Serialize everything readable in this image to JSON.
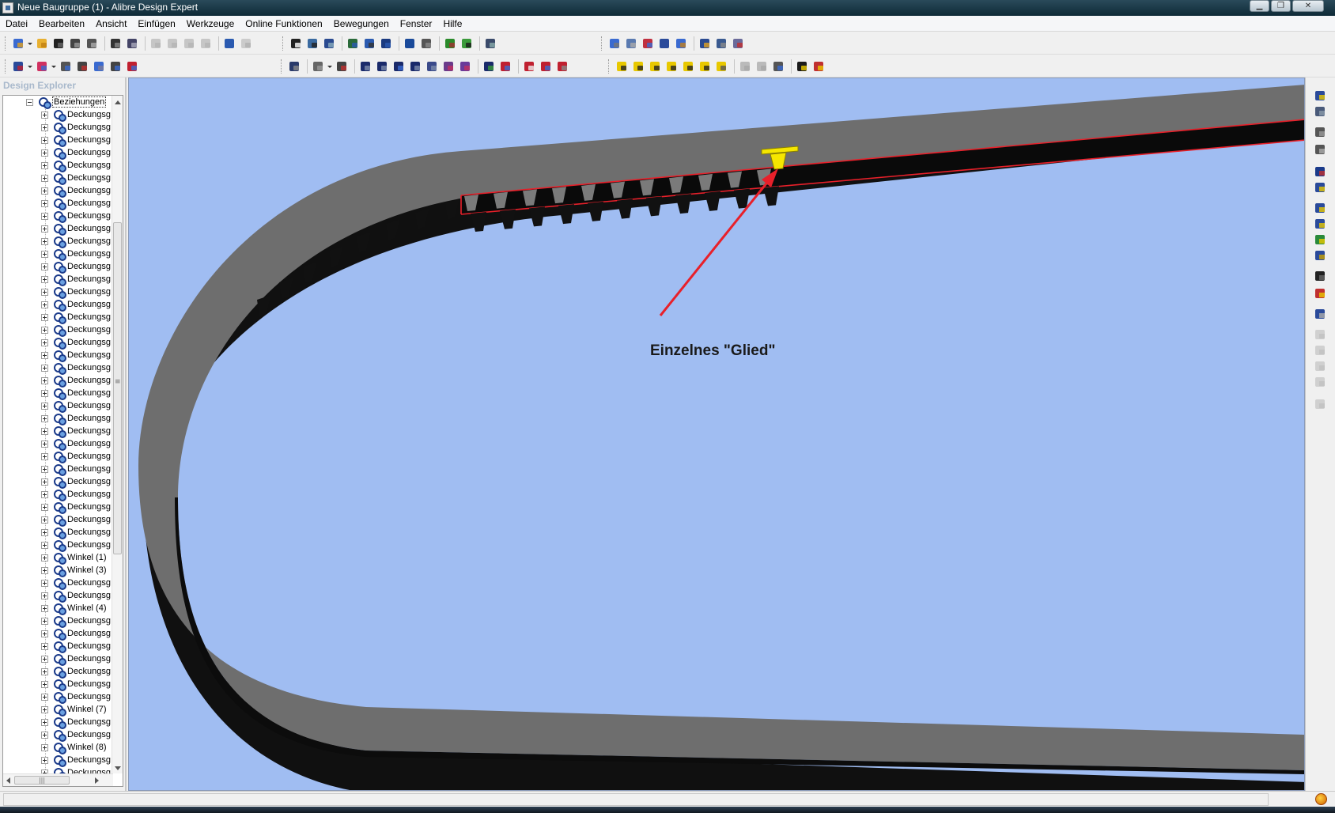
{
  "window": {
    "title": "Neue Baugruppe (1) - Alibre Design Expert",
    "controls": [
      "minimize",
      "maximize",
      "close"
    ]
  },
  "menu": {
    "items": [
      "Datei",
      "Bearbeiten",
      "Ansicht",
      "Einfügen",
      "Werkzeuge",
      "Online Funktionen",
      "Bewegungen",
      "Fenster",
      "Hilfe"
    ]
  },
  "explorer": {
    "title": "Design Explorer",
    "root_label": "Beziehungen",
    "items": [
      "Deckungsg",
      "Deckungsg",
      "Deckungsg",
      "Deckungsg",
      "Deckungsg",
      "Deckungsg",
      "Deckungsg",
      "Deckungsg",
      "Deckungsg",
      "Deckungsg",
      "Deckungsg",
      "Deckungsg",
      "Deckungsg",
      "Deckungsg",
      "Deckungsg",
      "Deckungsg",
      "Deckungsg",
      "Deckungsg",
      "Deckungsg",
      "Deckungsg",
      "Deckungsg",
      "Deckungsg",
      "Deckungsg",
      "Deckungsg",
      "Deckungsg",
      "Deckungsg",
      "Deckungsg",
      "Deckungsg",
      "Deckungsg",
      "Deckungsg",
      "Deckungsg",
      "Deckungsg",
      "Deckungsg",
      "Deckungsg",
      "Deckungsg",
      "Winkel (1)",
      "Winkel (3)",
      "Deckungsg",
      "Deckungsg",
      "Winkel (4)",
      "Deckungsg",
      "Deckungsg",
      "Deckungsg",
      "Deckungsg",
      "Deckungsg",
      "Deckungsg",
      "Deckungsg",
      "Winkel (7)",
      "Deckungsg",
      "Deckungsg",
      "Winkel (8)",
      "Deckungsg",
      "Deckungsg",
      "Deckungsg"
    ]
  },
  "viewport": {
    "annotation": "Einzelnes \"Glied\"",
    "background_color": "#a0bdf2",
    "belt_color": "#6e6e6e",
    "highlight_color": "#f5e600",
    "arrow_color": "#e8202a"
  },
  "icons": {
    "toolbar_row_1": [
      "new-icon",
      "open-icon",
      "save-icon",
      "save-all-icon",
      "print-icon",
      "cut-icon",
      "copy-icon",
      "paste-icon",
      "undo-icon",
      "redo-icon",
      "select-icon",
      "zoom-icon",
      "rotate-icon"
    ],
    "toolbar_row_2": [
      "part-icon",
      "constraint-icon",
      "motion-icon",
      "view-cube-icon",
      "pdf-icon",
      "render-icon"
    ]
  }
}
